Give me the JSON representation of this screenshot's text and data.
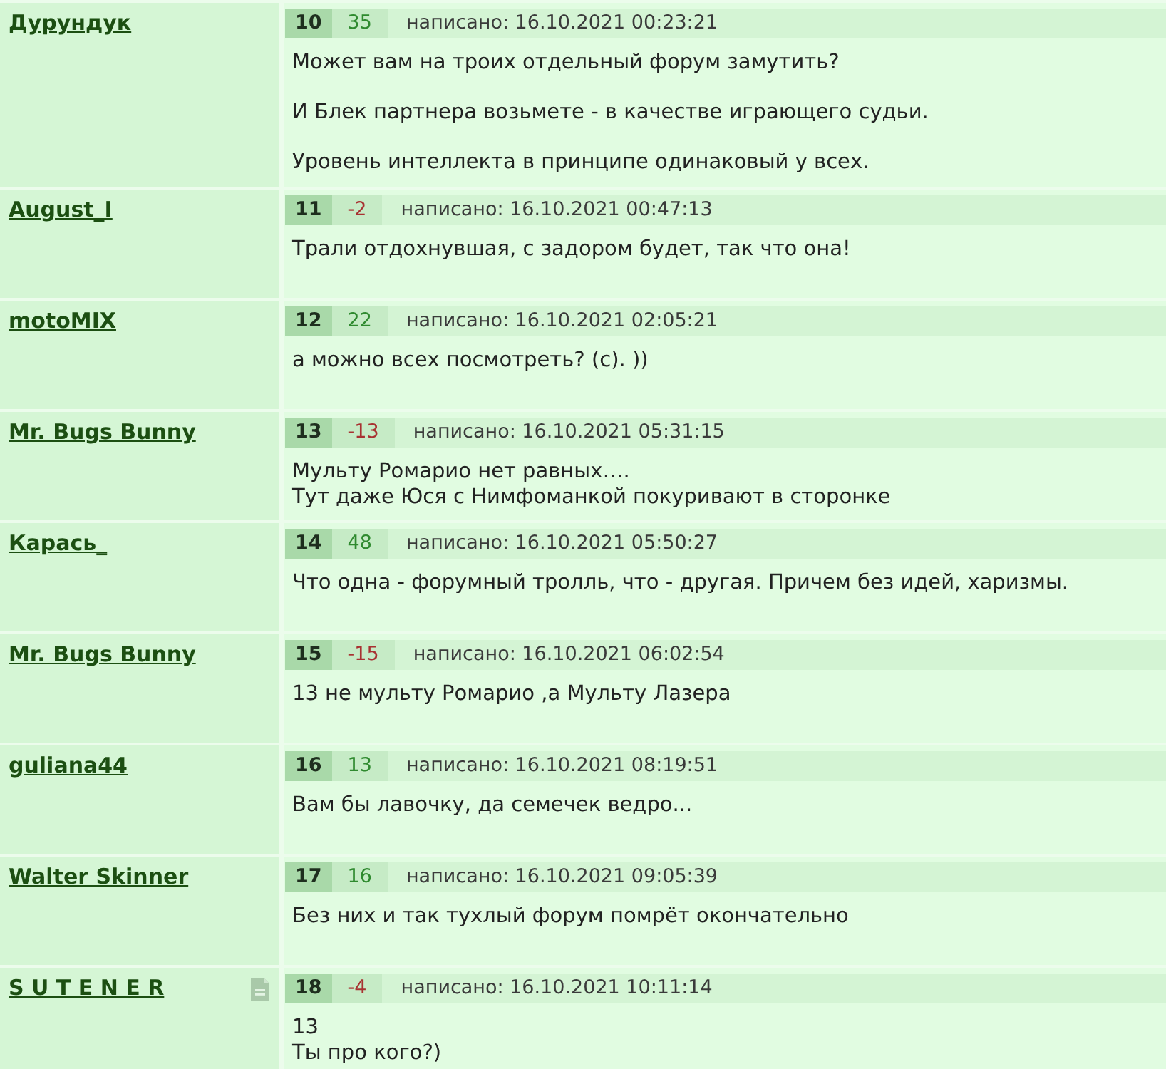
{
  "posts": [
    {
      "author": "Дурундук",
      "file_icon": false,
      "number": "10",
      "score": "35",
      "negative": false,
      "posted": "написано: 16.10.2021 00:23:21",
      "paragraphs": [
        [
          "Может вам на троих отдельный форум замутить?"
        ],
        [
          "И Блек партнера возьмете - в качестве играющего судьи."
        ],
        [
          "Уровень интеллекта в принципе одинаковый у всех."
        ]
      ]
    },
    {
      "author": "August_I",
      "file_icon": false,
      "number": "11",
      "score": "-2",
      "negative": true,
      "posted": "написано: 16.10.2021 00:47:13",
      "paragraphs": [
        [
          "Трали отдохнувшая, с задором будет, так что она!"
        ]
      ]
    },
    {
      "author": "motoMIX",
      "file_icon": false,
      "number": "12",
      "score": "22",
      "negative": false,
      "posted": "написано: 16.10.2021 02:05:21",
      "paragraphs": [
        [
          "а можно всех посмотреть? (с). ))"
        ]
      ]
    },
    {
      "author": "Mr. Bugs Bunny",
      "file_icon": false,
      "number": "13",
      "score": "-13",
      "negative": true,
      "posted": "написано: 16.10.2021 05:31:15",
      "paragraphs": [
        [
          "Мульту Ромарио нет равных….",
          "Тут даже Юся с Нимфоманкой покуривают в сторонке"
        ]
      ]
    },
    {
      "author": "Карась_",
      "file_icon": false,
      "number": "14",
      "score": "48",
      "negative": false,
      "posted": "написано: 16.10.2021 05:50:27",
      "paragraphs": [
        [
          "Что одна - форумный тролль, что - другая. Причем без идей, харизмы."
        ]
      ]
    },
    {
      "author": "Mr. Bugs Bunny",
      "file_icon": false,
      "number": "15",
      "score": "-15",
      "negative": true,
      "posted": "написано: 16.10.2021 06:02:54",
      "paragraphs": [
        [
          "13 не мульту Ромарио ,а Мульту Лазера"
        ]
      ]
    },
    {
      "author": "guliana44",
      "file_icon": false,
      "number": "16",
      "score": "13",
      "negative": false,
      "posted": "написано: 16.10.2021 08:19:51",
      "paragraphs": [
        [
          "Вам бы лавочку, да семечек ведро..."
        ]
      ]
    },
    {
      "author": "Walter Skinner",
      "file_icon": false,
      "number": "17",
      "score": "16",
      "negative": false,
      "posted": "написано: 16.10.2021 09:05:39",
      "paragraphs": [
        [
          "Без них и так тухлый форум помрёт окончательно"
        ]
      ]
    },
    {
      "author": "S U T E N E R",
      "file_icon": true,
      "number": "18",
      "score": "-4",
      "negative": true,
      "posted": "написано: 16.10.2021 10:11:14",
      "paragraphs": [
        [
          "13",
          "Ты про кого?)"
        ]
      ]
    }
  ]
}
